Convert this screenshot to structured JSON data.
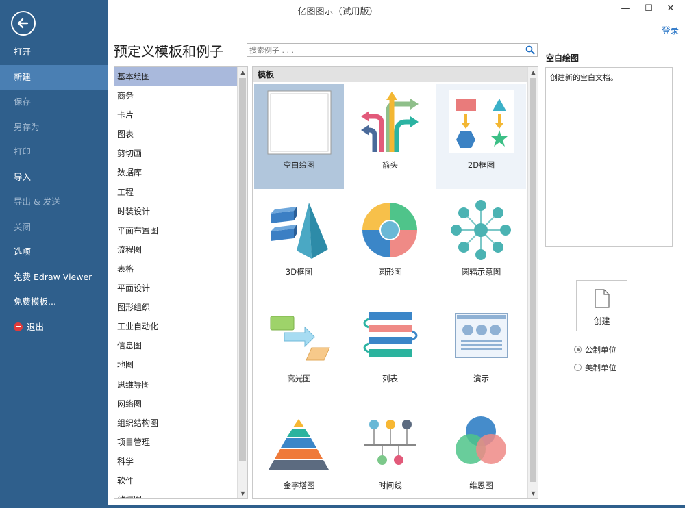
{
  "window": {
    "title": "亿图图示（试用版）",
    "minimize": "—",
    "maximize": "☐",
    "close": "✕",
    "login": "登录"
  },
  "sidebar": {
    "items": [
      {
        "label": "打开",
        "state": "normal"
      },
      {
        "label": "新建",
        "state": "active"
      },
      {
        "label": "保存",
        "state": "disabled"
      },
      {
        "label": "另存为",
        "state": "disabled"
      },
      {
        "label": "打印",
        "state": "disabled"
      },
      {
        "label": "导入",
        "state": "normal"
      },
      {
        "label": "导出 & 发送",
        "state": "disabled"
      },
      {
        "label": "关闭",
        "state": "disabled"
      },
      {
        "label": "选项",
        "state": "normal"
      },
      {
        "label": "免费 Edraw Viewer",
        "state": "normal"
      },
      {
        "label": "免费模板...",
        "state": "normal"
      },
      {
        "label": "退出",
        "state": "normal"
      }
    ]
  },
  "header": {
    "title": "预定义模板和例子",
    "search_placeholder": "搜索例子 . . ."
  },
  "categories": [
    "基本绘图",
    "商务",
    "卡片",
    "图表",
    "剪切画",
    "数据库",
    "工程",
    "时装设计",
    "平面布置图",
    "流程图",
    "表格",
    "平面设计",
    "图形组织",
    "工业自动化",
    "信息图",
    "地图",
    "思维导图",
    "网络图",
    "组织结构图",
    "项目管理",
    "科学",
    "软件",
    "线框图"
  ],
  "templates": {
    "header": "模板",
    "items": [
      {
        "label": "空白绘图",
        "icon": "blank-page-icon"
      },
      {
        "label": "箭头",
        "icon": "arrows-icon"
      },
      {
        "label": "2D框图",
        "icon": "2d-block-icon"
      },
      {
        "label": "3D框图",
        "icon": "3d-block-icon"
      },
      {
        "label": "圆形图",
        "icon": "circle-chart-icon"
      },
      {
        "label": "圆辐示意图",
        "icon": "radial-diagram-icon"
      },
      {
        "label": "高光图",
        "icon": "highlight-icon"
      },
      {
        "label": "列表",
        "icon": "list-icon"
      },
      {
        "label": "演示",
        "icon": "presentation-icon"
      },
      {
        "label": "金字塔图",
        "icon": "pyramid-icon"
      },
      {
        "label": "时间线",
        "icon": "timeline-icon"
      },
      {
        "label": "维恩图",
        "icon": "venn-icon"
      }
    ]
  },
  "preview": {
    "title": "空白绘图",
    "description": "创建新的空白文档。"
  },
  "create": {
    "label": "创建"
  },
  "units": [
    {
      "label": "公制单位",
      "checked": true
    },
    {
      "label": "美制单位",
      "checked": false
    }
  ],
  "colors": {
    "sidebar": "#2f5f8c",
    "sidebar_active": "#4a7fb3",
    "selected_category": "#a9b9dc",
    "selected_tile": "#b1c6dc",
    "link": "#1f6fc4"
  }
}
